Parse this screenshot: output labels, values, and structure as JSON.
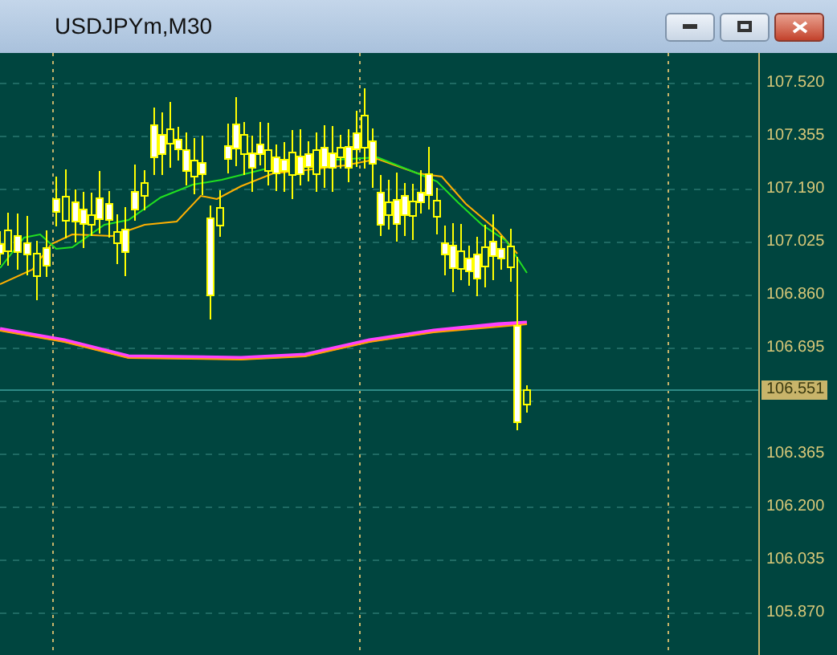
{
  "window": {
    "title": "USDJPYm,M30"
  },
  "price_axis": {
    "ticks": [
      "107.520",
      "107.355",
      "107.190",
      "107.025",
      "106.860",
      "106.695",
      "106.365",
      "106.200",
      "106.035",
      "105.870"
    ],
    "current_price": "106.551"
  }
}
